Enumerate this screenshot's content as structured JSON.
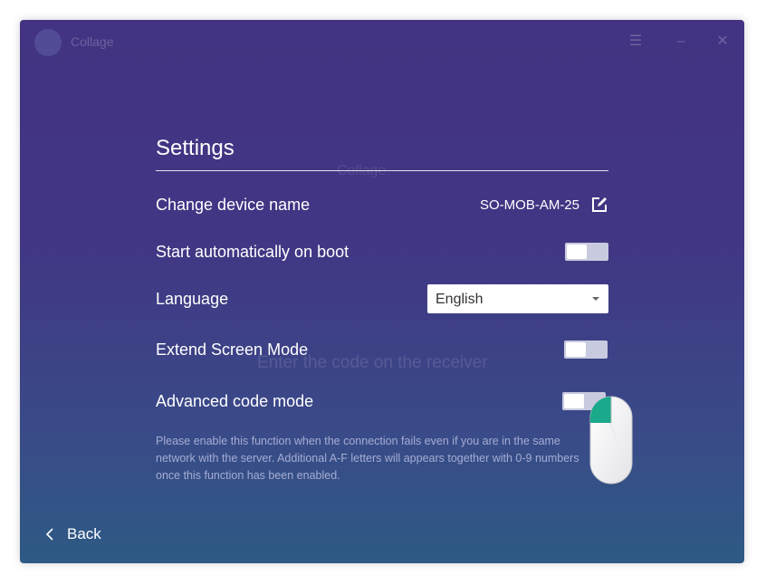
{
  "app": {
    "title": "Collage"
  },
  "background": {
    "logo_text": "Collage",
    "hint": "Enter the code on the receiver"
  },
  "settings": {
    "title": "Settings",
    "device_name_label": "Change device name",
    "device_name_value": "SO-MOB-AM-25",
    "auto_start_label": "Start automatically on boot",
    "auto_start_on": false,
    "language_label": "Language",
    "language_value": "English",
    "extend_screen_label": "Extend Screen Mode",
    "extend_screen_on": false,
    "advanced_code_label": "Advanced code mode",
    "advanced_code_on": false,
    "advanced_code_description": "Please enable this function when the connection fails even if you are in the same network with the server. Additional A-F letters will appears together with 0-9 numbers once this function has been enabled."
  },
  "footer": {
    "back_label": "Back"
  },
  "icons": {
    "edit": "edit-icon",
    "back": "chevron-left-icon",
    "dropdown": "caret-down-icon",
    "mouse": "mouse-left-click-icon"
  },
  "colors": {
    "background_top": "#433382",
    "background_bottom": "#2d5a84",
    "toggle_off": "#c8cae0",
    "description_text": "#a6acd4",
    "mouse_button_accent": "#1aa98a"
  }
}
